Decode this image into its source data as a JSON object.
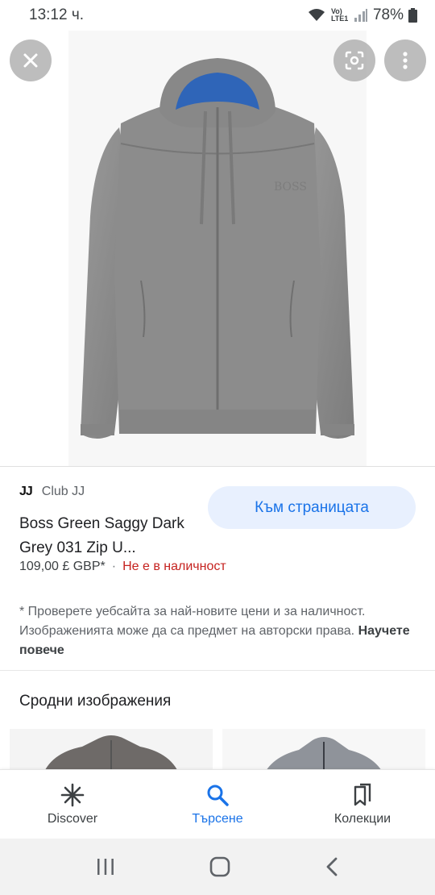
{
  "status_bar": {
    "time": "13:12 ч.",
    "network": "Vo) LTE1",
    "battery": "78%"
  },
  "image_viewer": {
    "icons": {
      "close": "close-icon",
      "lens": "google-lens-icon",
      "more": "more-vert-icon"
    },
    "image_label": "BOSS"
  },
  "result": {
    "source_logo": "JJ",
    "source_name": "Club JJ",
    "visit_button": "Към страницата",
    "title": "Boss Green Saggy Dark Grey 031 Zip U...",
    "price": "109,00 £ GBP*",
    "separator": "·",
    "stock_status": "Не е в наличност",
    "disclaimer": "* Проверете уебсайта за най-новите цени и за наличност. Изображенията може да са предмет на авторски права.",
    "learn_more": "Научете повече"
  },
  "related": {
    "title": "Сродни изображения"
  },
  "bottom_nav": {
    "items": [
      {
        "label": "Discover",
        "icon": "asterisk-icon",
        "active": false
      },
      {
        "label": "Търсене",
        "icon": "search-icon",
        "active": true
      },
      {
        "label": "Колекции",
        "icon": "collections-icon",
        "active": false
      }
    ]
  },
  "system_nav": {
    "icons": [
      "recents-icon",
      "home-icon",
      "back-icon"
    ]
  },
  "colors": {
    "accent": "#1a73e8",
    "accent_bg": "#e8f0fe",
    "out_of_stock": "#c5221f",
    "garment": "#8a8a8a"
  }
}
